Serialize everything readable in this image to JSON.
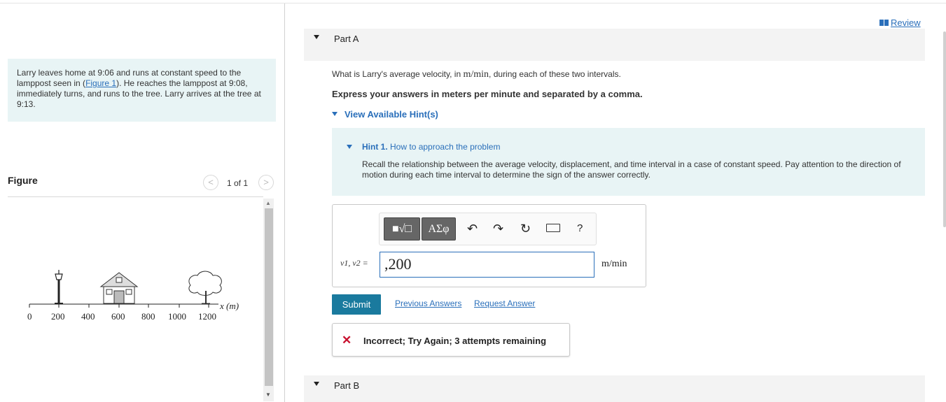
{
  "problem": {
    "text_before": "Larry leaves home at 9:06 and runs at constant speed to the lamppost seen in (",
    "figure_link": "Figure 1",
    "text_after": "). He reaches the lamppost at 9:08, immediately turns, and runs to the tree. Larry arrives at the tree at 9:13."
  },
  "figure_panel": {
    "title": "Figure",
    "count": "1 of 1",
    "prev_icon": "chevron-left-icon",
    "next_icon": "chevron-right-icon",
    "axis_label": "x (m)",
    "ticks": [
      "0",
      "200",
      "400",
      "600",
      "800",
      "1000",
      "1200"
    ]
  },
  "review_link": "Review",
  "part_a": {
    "label": "Part A"
  },
  "part_b": {
    "label": "Part B"
  },
  "question": {
    "prefix": "What is Larry's average velocity, in ",
    "unit": "m/min",
    "suffix": ", during each of these two intervals."
  },
  "express": "Express your answers in meters per minute and separated by a comma.",
  "hints_toggle": "View Available Hint(s)",
  "hint": {
    "number": "Hint 1.",
    "title": "How to approach the problem",
    "body": "Recall the relationship between the average velocity, displacement, and time interval in a case of constant speed. Pay attention to the direction of motion during each time interval to determine the sign of the answer correctly."
  },
  "toolbar": {
    "matrix_label": "■√□",
    "greek_label": "ΑΣφ",
    "undo_icon": "undo-icon",
    "redo_icon": "redo-icon",
    "reset_icon": "reset-icon",
    "keyboard_icon": "keyboard-icon",
    "help_label": "?"
  },
  "answer": {
    "variable_label": "v1, v2 =",
    "value": ",200",
    "unit": "m/min"
  },
  "buttons": {
    "submit": "Submit",
    "previous_answers": "Previous Answers",
    "request_answer": "Request Answer"
  },
  "feedback": {
    "icon": "x-icon",
    "text": "Incorrect; Try Again; 3 attempts remaining",
    "color": "#c8102e"
  },
  "colors": {
    "accent": "#2a6fba",
    "submit_bg": "#1a7a9e",
    "panel_bg": "#e8f4f5"
  }
}
